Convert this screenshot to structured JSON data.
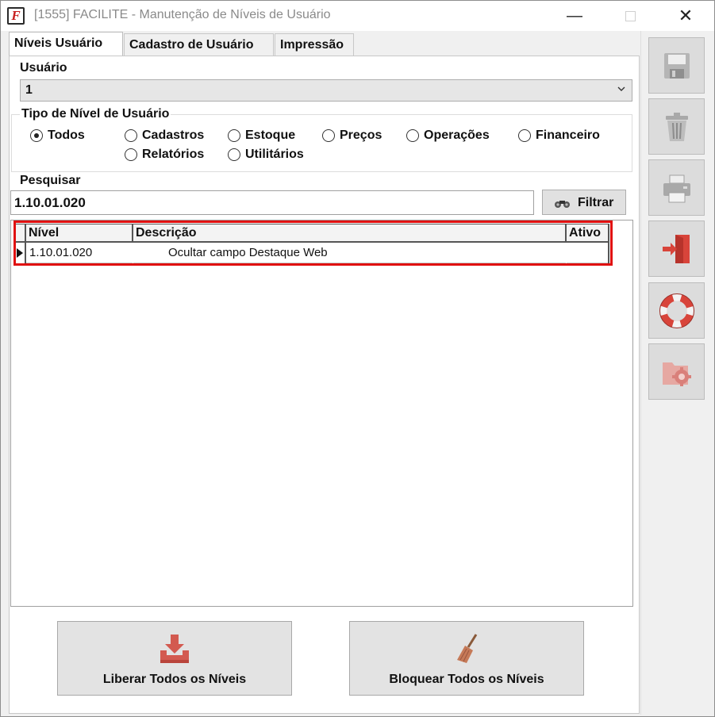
{
  "window": {
    "title": "[1555] FACILITE - Manutenção de Níveis de Usuário",
    "app_icon_letter": "F",
    "minimize_glyph": "—",
    "close_glyph": "✕"
  },
  "tabs": [
    {
      "label": "Níveis Usuário",
      "active": true
    },
    {
      "label": "Cadastro de Usuário",
      "active": false
    },
    {
      "label": "Impressão",
      "active": false
    }
  ],
  "user": {
    "label": "Usuário",
    "selected_value": "1"
  },
  "level_type": {
    "title": "Tipo de Nível de Usuário",
    "options": [
      {
        "label": "Todos",
        "selected": true
      },
      {
        "label": "Cadastros",
        "selected": false
      },
      {
        "label": "Estoque",
        "selected": false
      },
      {
        "label": "Preços",
        "selected": false
      },
      {
        "label": "Operações",
        "selected": false
      },
      {
        "label": "Financeiro",
        "selected": false
      },
      {
        "label": "Relatórios",
        "selected": false
      },
      {
        "label": "Utilitários",
        "selected": false
      }
    ]
  },
  "search": {
    "label": "Pesquisar",
    "value": "1.10.01.020",
    "filter_button": "Filtrar"
  },
  "grid": {
    "columns": [
      "Nível",
      "Descrição",
      "Ativo"
    ],
    "rows": [
      {
        "nivel": "1.10.01.020",
        "descricao": "Ocultar campo Destaque Web",
        "ativo": ""
      }
    ]
  },
  "actions": {
    "release_all": "Liberar Todos os Níveis",
    "block_all": "Bloquear Todos os Níveis"
  },
  "sidebar": {
    "icons": [
      "save-icon",
      "delete-icon",
      "print-icon",
      "exit-icon",
      "help-icon",
      "settings-icon"
    ]
  },
  "colors": {
    "highlight_border": "#e01010",
    "accent_red": "#d8443a"
  }
}
